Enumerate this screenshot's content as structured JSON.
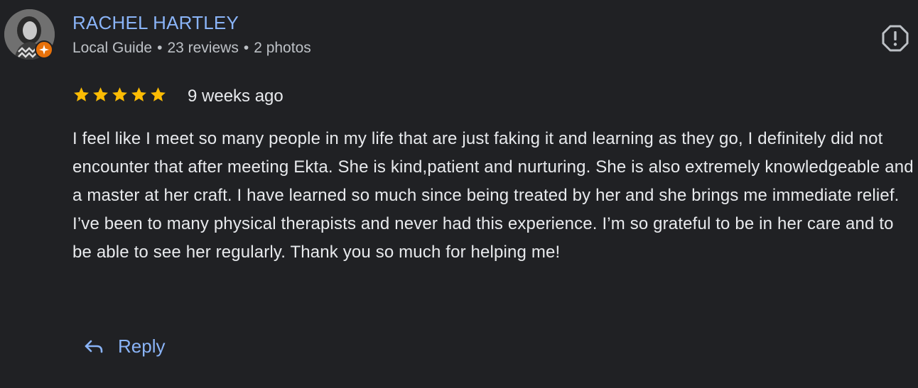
{
  "review": {
    "author": {
      "name": "RACHEL HARTLEY",
      "role": "Local Guide",
      "reviews": "23 reviews",
      "photos": "2 photos",
      "separator": "•"
    },
    "rating": 5,
    "date": "9 weeks ago",
    "text": "I feel like I meet so many people in my life that are just faking it and learning as they go, I definitely did not encounter that after meeting Ekta. She is kind,patient and nurturing. She is also extremely knowledgeable and a master at her craft. I have learned so much since being treated by her and she brings me immediate relief. I’ve been to many physical therapists and never had this experience. I’m so grateful to be in her care and to be able to see her regularly. Thank you so much for helping me!",
    "reply_label": "Reply"
  },
  "icons": {
    "avatar": "avatar-photo",
    "guide_badge": "local-guide-star-icon",
    "flag": "report-flag-icon",
    "star": "star-icon",
    "reply": "reply-arrow-icon"
  },
  "colors": {
    "background": "#202124",
    "author_name": "#8ab4f8",
    "meta_text": "#bdc1c6",
    "body_text": "#e8eaed",
    "star": "#fbbc04",
    "badge": "#e8710a",
    "reply": "#8ab4f8"
  }
}
